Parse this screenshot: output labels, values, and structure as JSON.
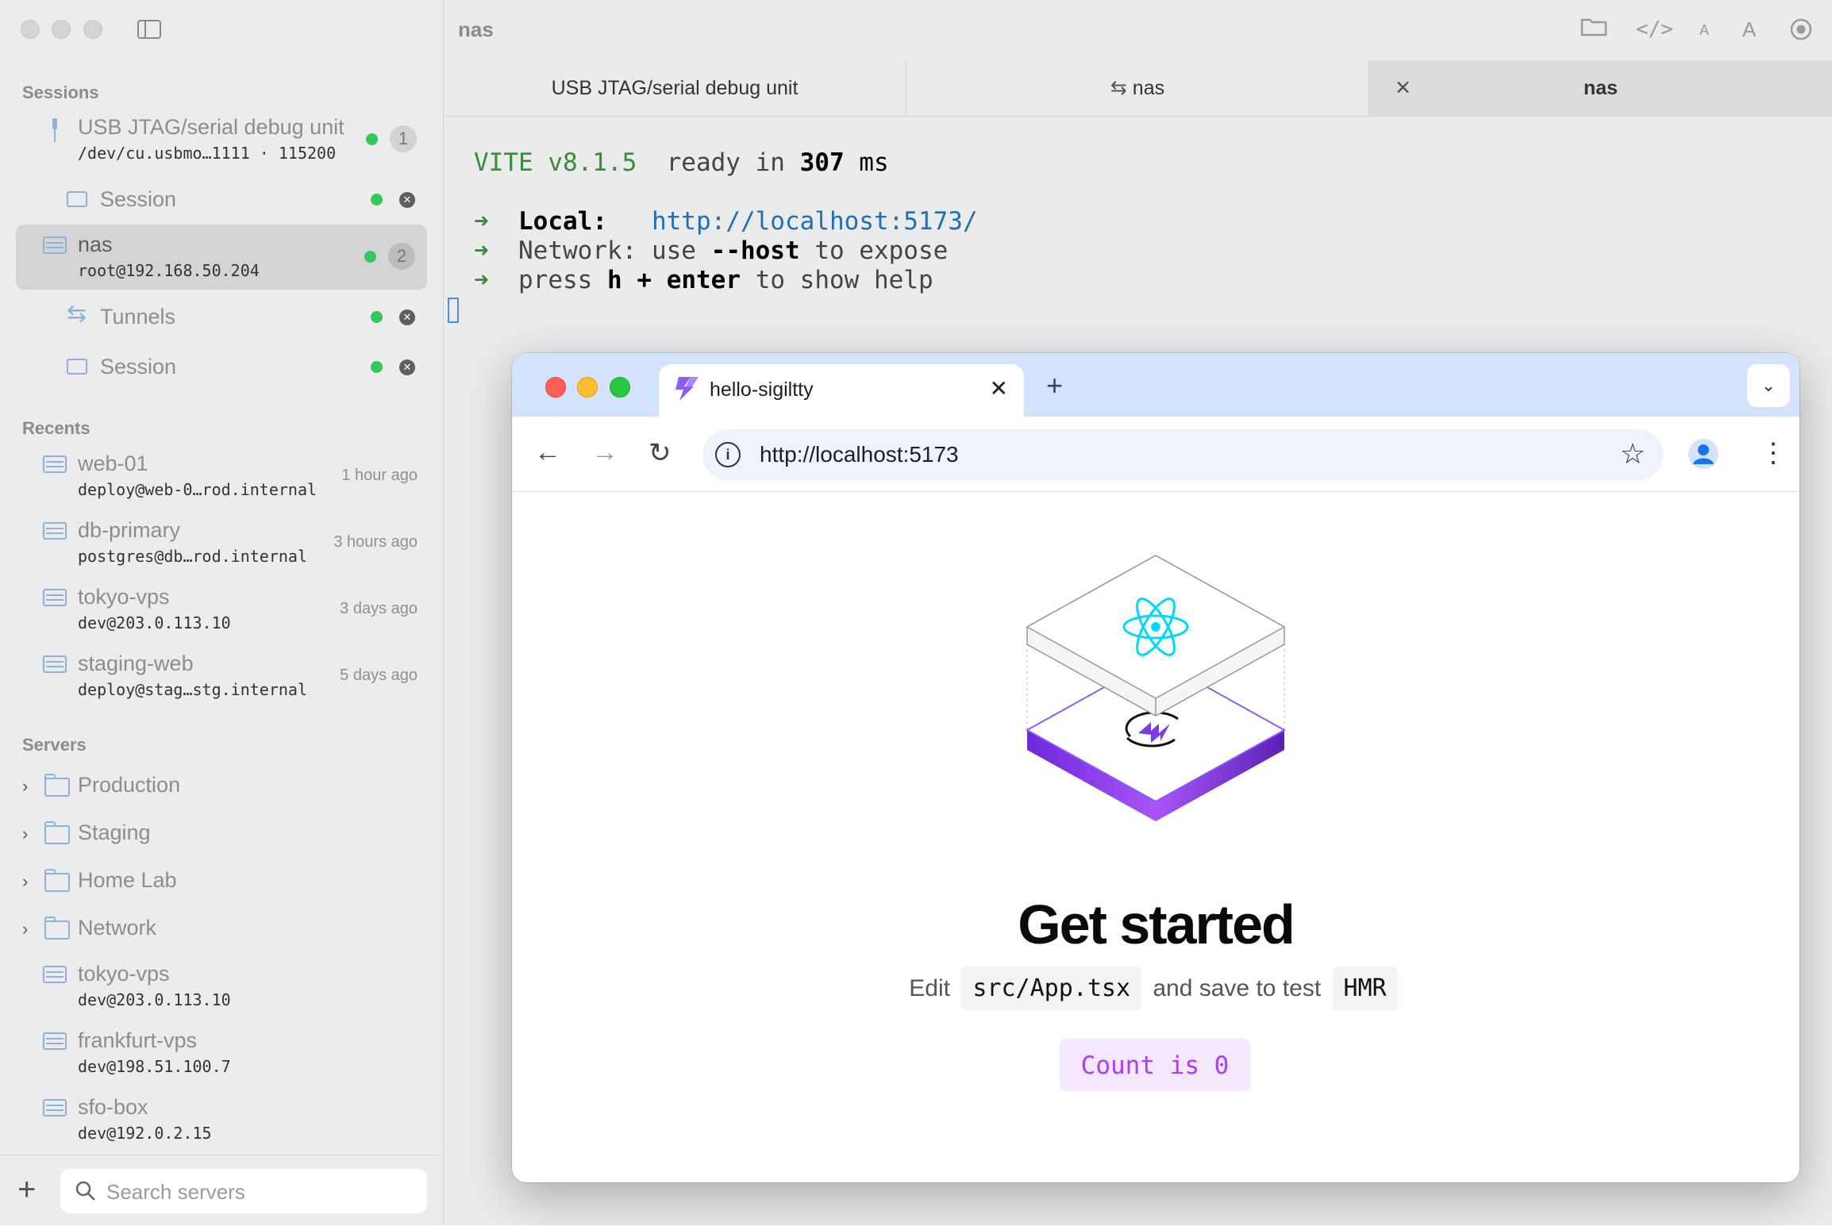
{
  "sidebar": {
    "sessions_title": "Sessions",
    "sessions": [
      {
        "name": "USB JTAG/serial debug unit",
        "sub": "/dev/cu.usbmo…1111 · 115200",
        "count": "1"
      },
      {
        "name": "Session"
      },
      {
        "name": "nas",
        "sub": "root@192.168.50.204",
        "count": "2"
      },
      {
        "name": "Tunnels"
      },
      {
        "name": "Session"
      }
    ],
    "recents_title": "Recents",
    "recents": [
      {
        "name": "web-01",
        "sub": "deploy@web-0…rod.internal",
        "when": "1 hour ago"
      },
      {
        "name": "db-primary",
        "sub": "postgres@db…rod.internal",
        "when": "3 hours ago"
      },
      {
        "name": "tokyo-vps",
        "sub": "dev@203.0.113.10",
        "when": "3 days ago"
      },
      {
        "name": "staging-web",
        "sub": "deploy@stag…stg.internal",
        "when": "5 days ago"
      }
    ],
    "servers_title": "Servers",
    "folders": [
      "Production",
      "Staging",
      "Home Lab",
      "Network"
    ],
    "servers": [
      {
        "name": "tokyo-vps",
        "sub": "dev@203.0.113.10"
      },
      {
        "name": "frankfurt-vps",
        "sub": "dev@198.51.100.7"
      },
      {
        "name": "sfo-box",
        "sub": "dev@192.0.2.15"
      }
    ],
    "add_label": "+",
    "search_placeholder": "Search servers"
  },
  "window": {
    "title": "nas",
    "tabs": [
      "USB JTAG/serial debug unit",
      "nas",
      "nas"
    ]
  },
  "terminal": {
    "vite": "VITE v8.1.5",
    "ready": "ready in",
    "ms_value": "307",
    "ms_unit": "ms",
    "arrow": "➜",
    "local_label": "Local:",
    "local_url": "http://localhost:5173/",
    "network_label": "Network:",
    "network_use": "use",
    "network_flag": "--host",
    "network_rest": "to expose",
    "press": "press",
    "key_h": "h",
    "plus": "+",
    "key_enter": "enter",
    "help_rest": "to show help"
  },
  "browser": {
    "tab_title": "hello-sigiltty",
    "url": "http://localhost:5173",
    "heading": "Get started",
    "edit_prefix": "Edit",
    "edit_file": "src/App.tsx",
    "edit_mid": "and save to test",
    "edit_hmr": "HMR",
    "count_label": "Count is 0"
  },
  "colors": {
    "accent_green": "#34c759",
    "link_blue": "#1f6fb4",
    "count_purple": "#aa3bff",
    "count_bg": "#f3e8ff",
    "react_cyan": "#00d8ff",
    "vite_purple": "#7c3aed"
  }
}
